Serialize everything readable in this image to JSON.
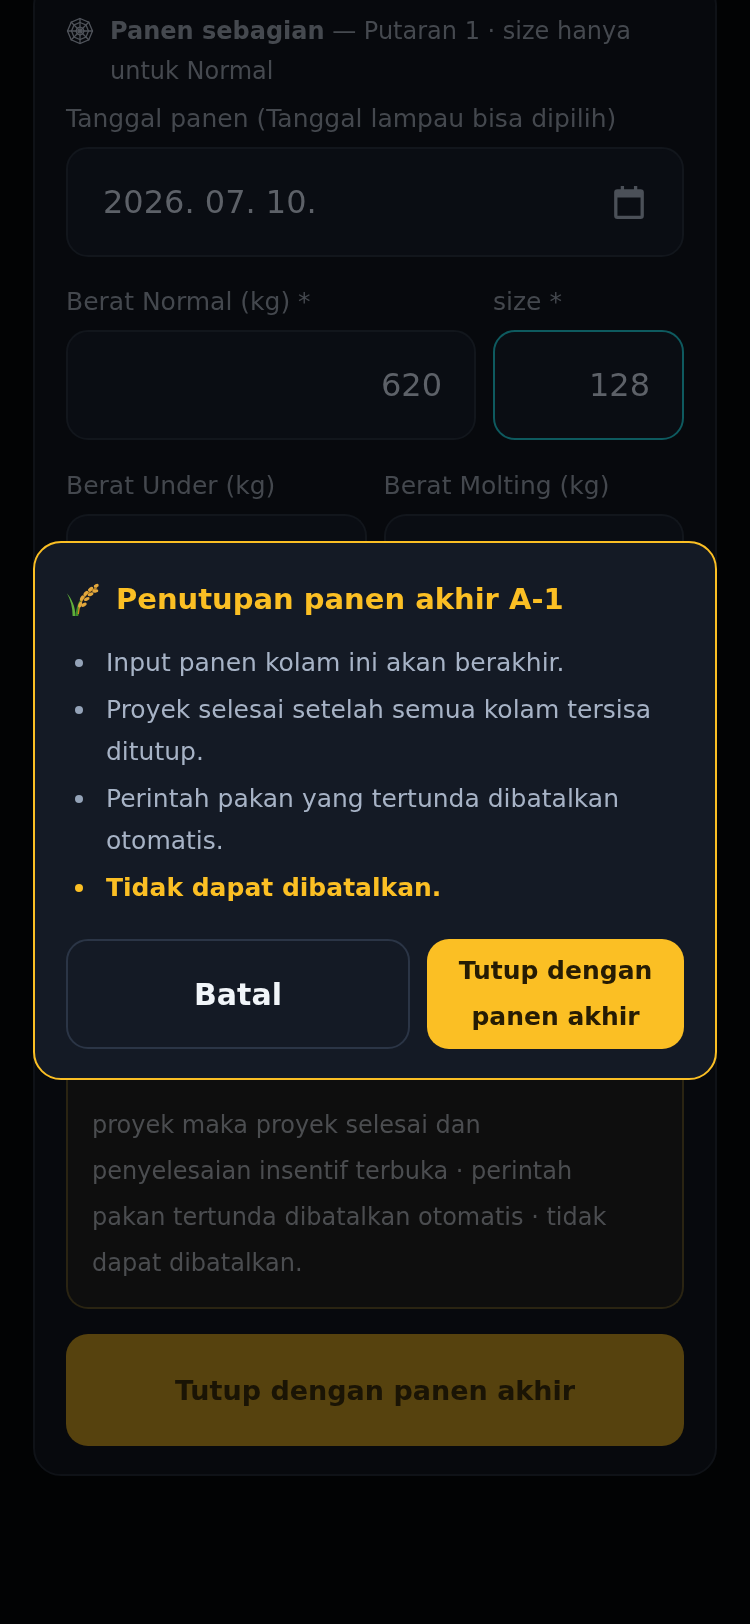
{
  "background": {
    "heading": "**Panen sebagian** — Putaran 1 · size hanya untuk Normal",
    "date_field": {
      "label": "Tanggal panen (Tanggal lampau bisa dipilih)",
      "value": "2026. 07. 10."
    },
    "weight_fields": [
      {
        "label": "Berat Normal (kg) *",
        "value": "620",
        "focused": false
      },
      {
        "label": "size *",
        "value": "128",
        "focused": true
      }
    ],
    "extra_fields": [
      {
        "label": "Berat Under (kg)"
      },
      {
        "label": "Berat Molting (kg)"
      }
    ],
    "warning_note": "proyek maka proyek selesai dan penyelesaian insentif terbuka · perintah pakan tertunda dibatalkan otomatis · tidak dapat dibatalkan.",
    "close_button": "Tutup dengan panen akhir"
  },
  "dialog": {
    "title": "Penutupan panen akhir A-1",
    "points": [
      {
        "text": "Input panen kolam ini akan berakhir.",
        "kind": "info"
      },
      {
        "text": "Proyek selesai setelah semua kolam tersisa ditutup.",
        "kind": "info"
      },
      {
        "text": "Perintah pakan yang tertunda dibatalkan otomatis.",
        "kind": "info"
      },
      {
        "text": "Tidak dapat dibatalkan.",
        "kind": "warning"
      }
    ],
    "buttons": [
      {
        "label": "Batal",
        "kind": "secondary"
      },
      {
        "label": "Tutup dengan panen akhir",
        "kind": "primary"
      }
    ]
  }
}
